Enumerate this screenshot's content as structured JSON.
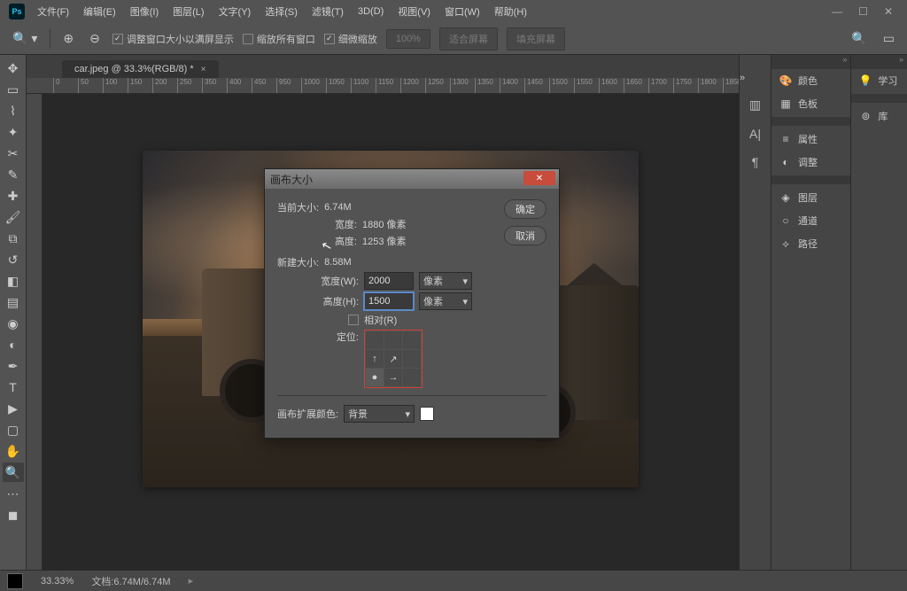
{
  "menubar": {
    "items": [
      "文件(F)",
      "编辑(E)",
      "图像(I)",
      "图层(L)",
      "文字(Y)",
      "选择(S)",
      "滤镜(T)",
      "3D(D)",
      "视图(V)",
      "窗口(W)",
      "帮助(H)"
    ]
  },
  "options": {
    "fit_window": "调整窗口大小以满屏显示",
    "zoom_all": "缩放所有窗口",
    "scrubby": "细微缩放",
    "pct_btn": "100%",
    "fit_screen": "适合屏幕",
    "fill_screen": "填充屏幕"
  },
  "tab": {
    "title": "car.jpeg @ 33.3%(RGB/8) *"
  },
  "ruler_marks": [
    "0",
    "50",
    "100",
    "150",
    "200",
    "250",
    "350",
    "400",
    "450",
    "950",
    "1000",
    "1050",
    "1100",
    "1150",
    "1200",
    "1250",
    "1300",
    "1350",
    "1400",
    "1450",
    "1500",
    "1550",
    "1600",
    "1650",
    "1700",
    "1750",
    "1800",
    "1850"
  ],
  "panels_right": {
    "col1": [
      {
        "icon": "🎨",
        "label": "颜色"
      },
      {
        "icon": "▦",
        "label": "色板"
      },
      {
        "icon": "≡",
        "label": "属性"
      },
      {
        "icon": "◐",
        "label": "调整"
      },
      {
        "icon": "◈",
        "label": "图层"
      },
      {
        "icon": "○",
        "label": "通道"
      },
      {
        "icon": "⟡",
        "label": "路径"
      }
    ],
    "col2": [
      {
        "icon": "💡",
        "label": "学习"
      },
      {
        "icon": "⊚",
        "label": "库"
      }
    ]
  },
  "dialog": {
    "title": "画布大小",
    "current_size_lbl": "当前大小:",
    "current_size_val": "6.74M",
    "width_lbl": "宽度:",
    "width_val": "1880 像素",
    "height_lbl": "高度:",
    "height_val": "1253 像素",
    "new_size_lbl": "新建大小:",
    "new_size_val": "8.58M",
    "w_lbl": "宽度(W):",
    "w_input": "2000",
    "h_lbl": "高度(H):",
    "h_input": "1500",
    "unit": "像素",
    "relative": "相对(R)",
    "anchor_lbl": "定位:",
    "ext_color_lbl": "画布扩展颜色:",
    "ext_color_val": "背景",
    "ok": "确定",
    "cancel": "取消"
  },
  "status": {
    "zoom": "33.33%",
    "doc": "文档:6.74M/6.74M"
  }
}
